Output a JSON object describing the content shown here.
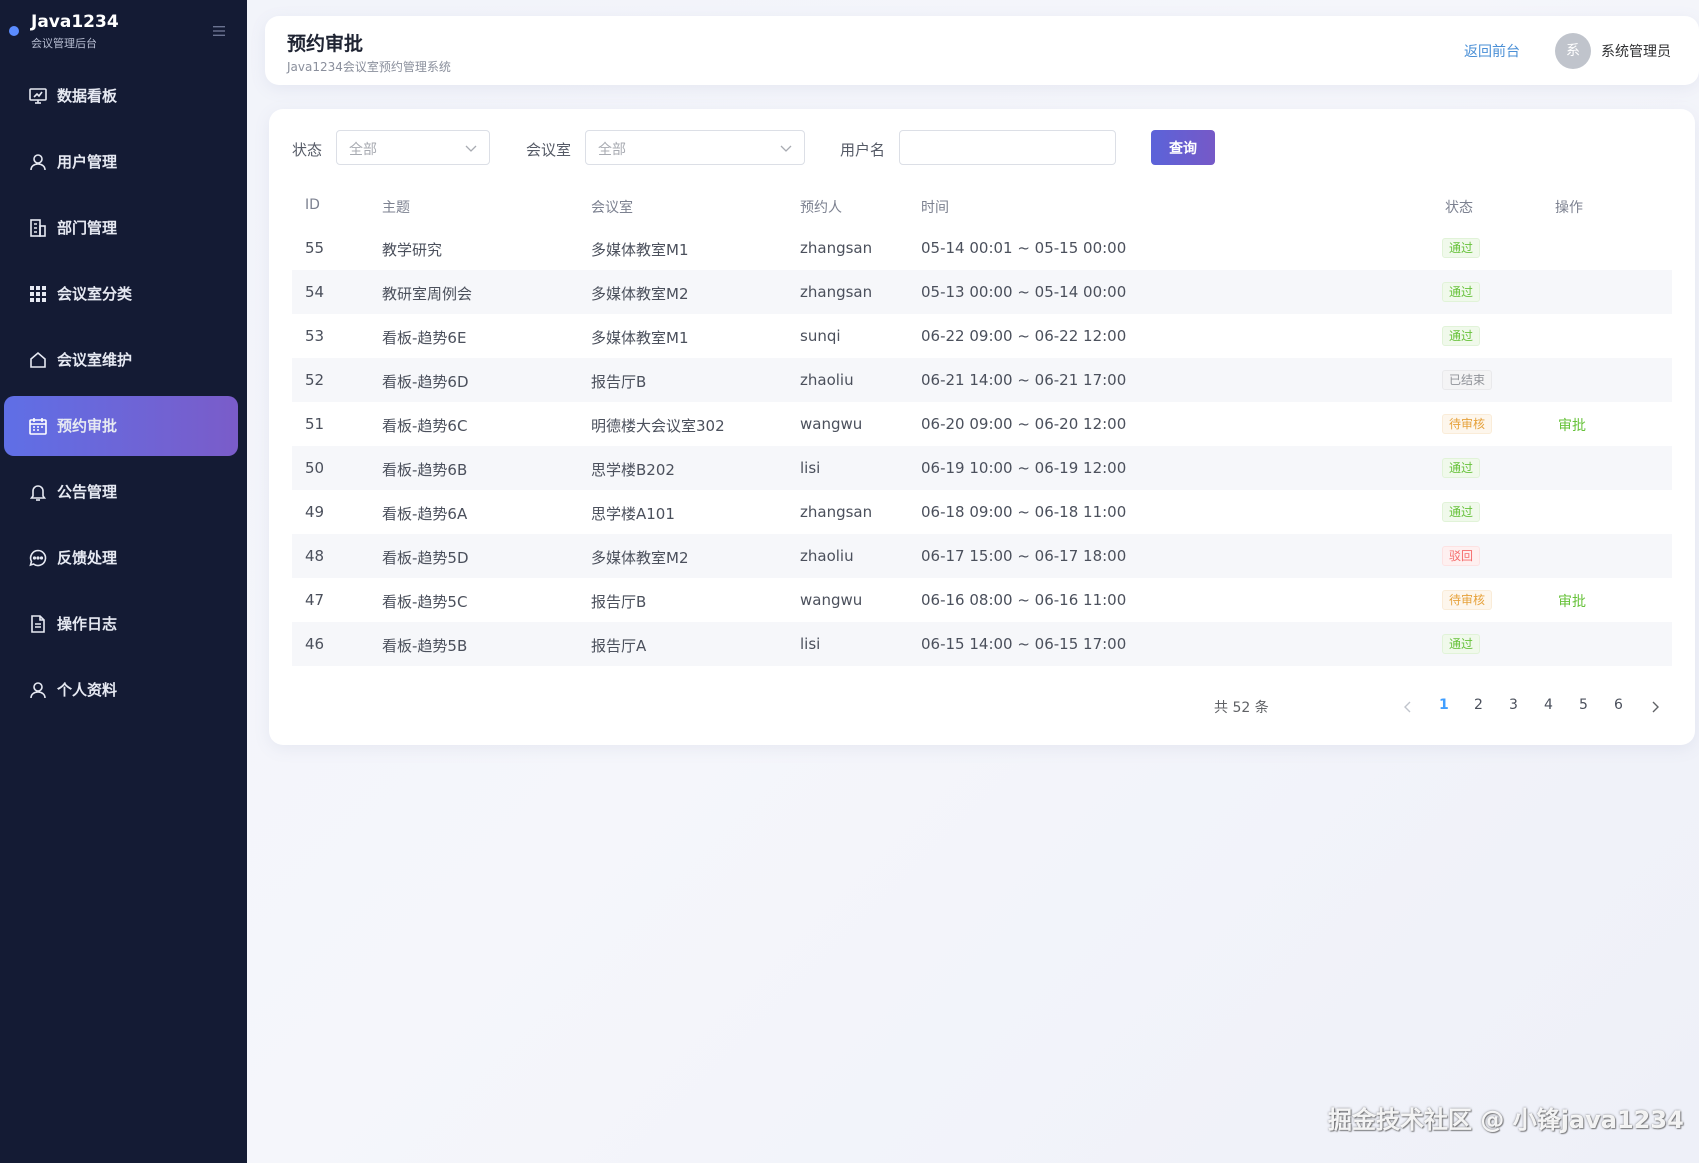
{
  "brand": {
    "title": "Java1234",
    "subtitle": "会议管理后台"
  },
  "sidebar": {
    "items": [
      {
        "label": "数据看板",
        "icon": "dashboard-icon"
      },
      {
        "label": "用户管理",
        "icon": "user-icon"
      },
      {
        "label": "部门管理",
        "icon": "building-icon"
      },
      {
        "label": "会议室分类",
        "icon": "grid-icon"
      },
      {
        "label": "会议室维护",
        "icon": "house-icon"
      },
      {
        "label": "预约审批",
        "icon": "calendar-icon",
        "active": true
      },
      {
        "label": "公告管理",
        "icon": "bell-icon"
      },
      {
        "label": "反馈处理",
        "icon": "chat-icon"
      },
      {
        "label": "操作日志",
        "icon": "document-icon"
      },
      {
        "label": "个人资料",
        "icon": "profile-icon"
      }
    ]
  },
  "header": {
    "title": "预约审批",
    "subtitle": "Java1234会议室预约管理系统",
    "back_link": "返回前台",
    "avatar_char": "系",
    "username": "系统管理员"
  },
  "filters": {
    "status_label": "状态",
    "status_value": "全部",
    "room_label": "会议室",
    "room_value": "全部",
    "username_label": "用户名",
    "username_value": "",
    "query_button": "查询"
  },
  "table": {
    "columns": [
      "ID",
      "主题",
      "会议室",
      "预约人",
      "时间",
      "状态",
      "操作"
    ],
    "rows": [
      {
        "id": "55",
        "topic": "教学研究",
        "room": "多媒体教室M1",
        "user": "zhangsan",
        "time": "05-14 00:01 ~ 05-15 00:00",
        "status": "通过",
        "status_type": "pass",
        "action": ""
      },
      {
        "id": "54",
        "topic": "教研室周例会",
        "room": "多媒体教室M2",
        "user": "zhangsan",
        "time": "05-13 00:00 ~ 05-14 00:00",
        "status": "通过",
        "status_type": "pass",
        "action": ""
      },
      {
        "id": "53",
        "topic": "看板-趋势6E",
        "room": "多媒体教室M1",
        "user": "sunqi",
        "time": "06-22 09:00 ~ 06-22 12:00",
        "status": "通过",
        "status_type": "pass",
        "action": ""
      },
      {
        "id": "52",
        "topic": "看板-趋势6D",
        "room": "报告厅B",
        "user": "zhaoliu",
        "time": "06-21 14:00 ~ 06-21 17:00",
        "status": "已结束",
        "status_type": "ended",
        "action": ""
      },
      {
        "id": "51",
        "topic": "看板-趋势6C",
        "room": "明德楼大会议室302",
        "user": "wangwu",
        "time": "06-20 09:00 ~ 06-20 12:00",
        "status": "待审核",
        "status_type": "pending",
        "action": "审批"
      },
      {
        "id": "50",
        "topic": "看板-趋势6B",
        "room": "思学楼B202",
        "user": "lisi",
        "time": "06-19 10:00 ~ 06-19 12:00",
        "status": "通过",
        "status_type": "pass",
        "action": ""
      },
      {
        "id": "49",
        "topic": "看板-趋势6A",
        "room": "思学楼A101",
        "user": "zhangsan",
        "time": "06-18 09:00 ~ 06-18 11:00",
        "status": "通过",
        "status_type": "pass",
        "action": ""
      },
      {
        "id": "48",
        "topic": "看板-趋势5D",
        "room": "多媒体教室M2",
        "user": "zhaoliu",
        "time": "06-17 15:00 ~ 06-17 18:00",
        "status": "驳回",
        "status_type": "rejected",
        "action": ""
      },
      {
        "id": "47",
        "topic": "看板-趋势5C",
        "room": "报告厅B",
        "user": "wangwu",
        "time": "06-16 08:00 ~ 06-16 11:00",
        "status": "待审核",
        "status_type": "pending",
        "action": "审批"
      },
      {
        "id": "46",
        "topic": "看板-趋势5B",
        "room": "报告厅A",
        "user": "lisi",
        "time": "06-15 14:00 ~ 06-15 17:00",
        "status": "通过",
        "status_type": "pass",
        "action": ""
      }
    ]
  },
  "pagination": {
    "total_text": "共 52 条",
    "pages": [
      "1",
      "2",
      "3",
      "4",
      "5",
      "6"
    ],
    "current": "1"
  },
  "watermark": "掘金技术社区 @ 小锋java1234",
  "colors": {
    "sidebar_bg": "#141b34",
    "accent_start": "#5f6fe6",
    "accent_end": "#7a5cc9",
    "link": "#4a8fd6",
    "success": "#67c23a",
    "warning": "#e6a23c",
    "danger": "#f56c6c"
  }
}
